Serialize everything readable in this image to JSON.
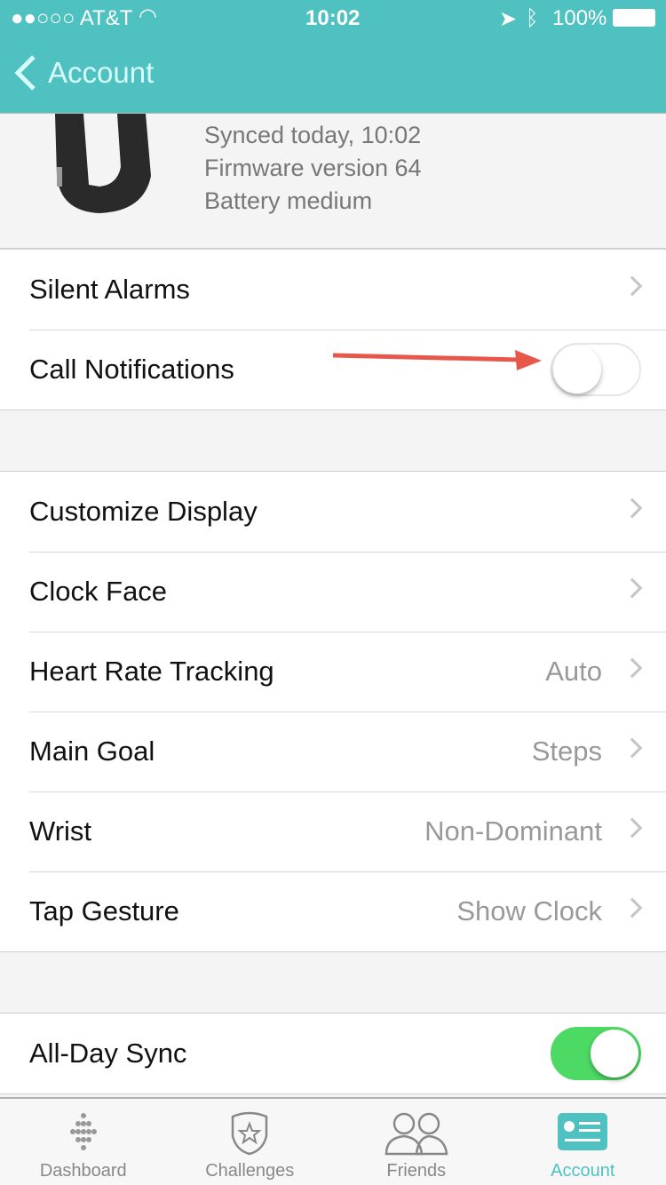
{
  "status_bar": {
    "carrier": "●●○○○ AT&T",
    "time": "10:02",
    "battery": "100%"
  },
  "nav": {
    "back_label": "Account"
  },
  "device": {
    "synced": "Synced today, 10:02",
    "firmware": "Firmware version 64",
    "battery": "Battery medium"
  },
  "group1": [
    {
      "label": "Silent Alarms"
    },
    {
      "label": "Call Notifications",
      "toggle": false
    }
  ],
  "group2": [
    {
      "label": "Customize Display",
      "value": ""
    },
    {
      "label": "Clock Face",
      "value": ""
    },
    {
      "label": "Heart Rate Tracking",
      "value": "Auto"
    },
    {
      "label": "Main Goal",
      "value": "Steps"
    },
    {
      "label": "Wrist",
      "value": "Non-Dominant"
    },
    {
      "label": "Tap Gesture",
      "value": "Show Clock"
    }
  ],
  "group3": [
    {
      "label": "All-Day Sync",
      "toggle": true
    }
  ],
  "colors": {
    "accent": "#4fc1c1",
    "toggle_on": "#4cd964",
    "annotation_arrow": "#e8584a"
  },
  "tabs": [
    {
      "label": "Dashboard",
      "icon": "dashboard-dots-icon"
    },
    {
      "label": "Challenges",
      "icon": "shield-star-icon"
    },
    {
      "label": "Friends",
      "icon": "people-icon"
    },
    {
      "label": "Account",
      "icon": "account-card-icon",
      "active": true
    }
  ]
}
